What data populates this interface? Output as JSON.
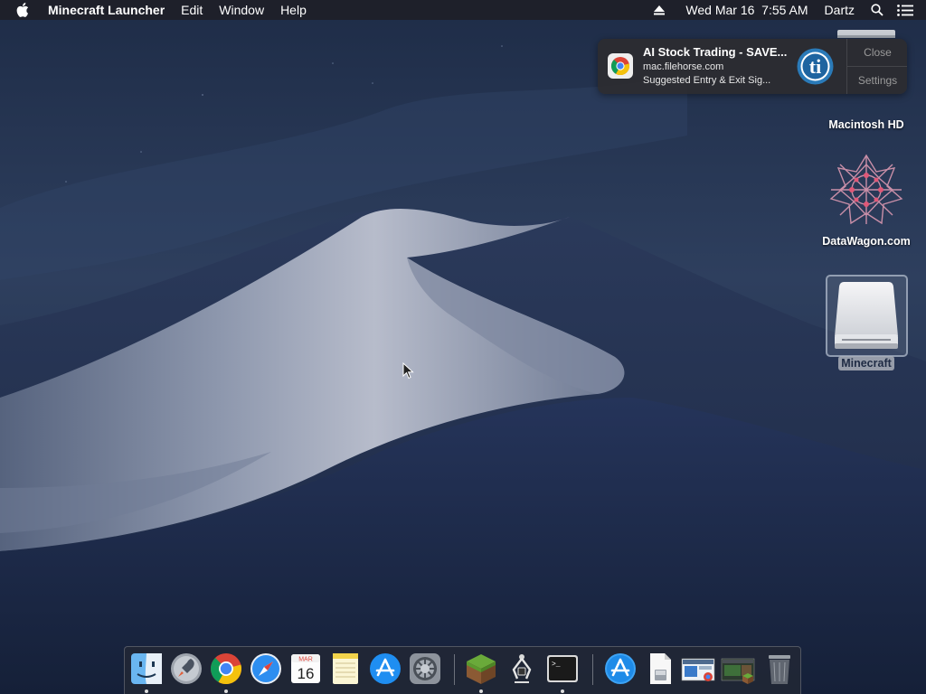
{
  "menubar": {
    "apple_icon": "apple-icon",
    "app_name": "Minecraft Launcher",
    "menus": [
      "Edit",
      "Window",
      "Help"
    ],
    "clock": "Wed Mar 16  7:55 AM",
    "user": "Dartz",
    "status_icons": [
      "eject-icon",
      "search-icon",
      "notification-center-icon"
    ]
  },
  "notification": {
    "title": "AI Stock Trading - SAVE...",
    "source": "mac.filehorse.com",
    "body": "Suggested Entry & Exit Sig...",
    "close_label": "Close",
    "settings_label": "Settings",
    "app_icon": "chrome-icon"
  },
  "desktop": {
    "icons": [
      {
        "label": "Macintosh HD",
        "icon": "hard-drive-icon"
      },
      {
        "label": "DataWagon.com",
        "icon": "datawagon-logo-icon"
      },
      {
        "label": "Minecraft",
        "icon": "disk-image-icon",
        "selected": true
      }
    ]
  },
  "dock": {
    "apps": [
      {
        "name": "Finder",
        "icon": "finder-icon",
        "running": true
      },
      {
        "name": "Launchpad",
        "icon": "launchpad-icon",
        "running": false
      },
      {
        "name": "Google Chrome",
        "icon": "chrome-icon",
        "running": true
      },
      {
        "name": "Safari",
        "icon": "safari-icon",
        "running": false
      },
      {
        "name": "Calendar",
        "icon": "calendar-icon",
        "running": false,
        "month": "MAR",
        "day": "16"
      },
      {
        "name": "Notes",
        "icon": "notes-icon",
        "running": false
      },
      {
        "name": "App Store",
        "icon": "app-store-icon",
        "running": false
      },
      {
        "name": "System Preferences",
        "icon": "system-preferences-icon",
        "running": false
      },
      {
        "name": "Minecraft",
        "icon": "minecraft-grass-block-icon",
        "running": true
      },
      {
        "name": "Utility",
        "icon": "claw-utility-icon",
        "running": false
      },
      {
        "name": "Terminal",
        "icon": "terminal-icon",
        "running": true,
        "prompt": ">_"
      },
      {
        "name": "Applications",
        "icon": "applications-folder-icon",
        "running": false
      },
      {
        "name": "Document",
        "icon": "document-icon",
        "running": false
      },
      {
        "name": "Chrome Screenshot",
        "icon": "screenshot-thumbnail-icon",
        "running": false
      },
      {
        "name": "Minecraft Screenshot",
        "icon": "minecraft-screenshot-icon",
        "running": false
      },
      {
        "name": "Trash",
        "icon": "trash-icon",
        "running": false
      }
    ]
  }
}
